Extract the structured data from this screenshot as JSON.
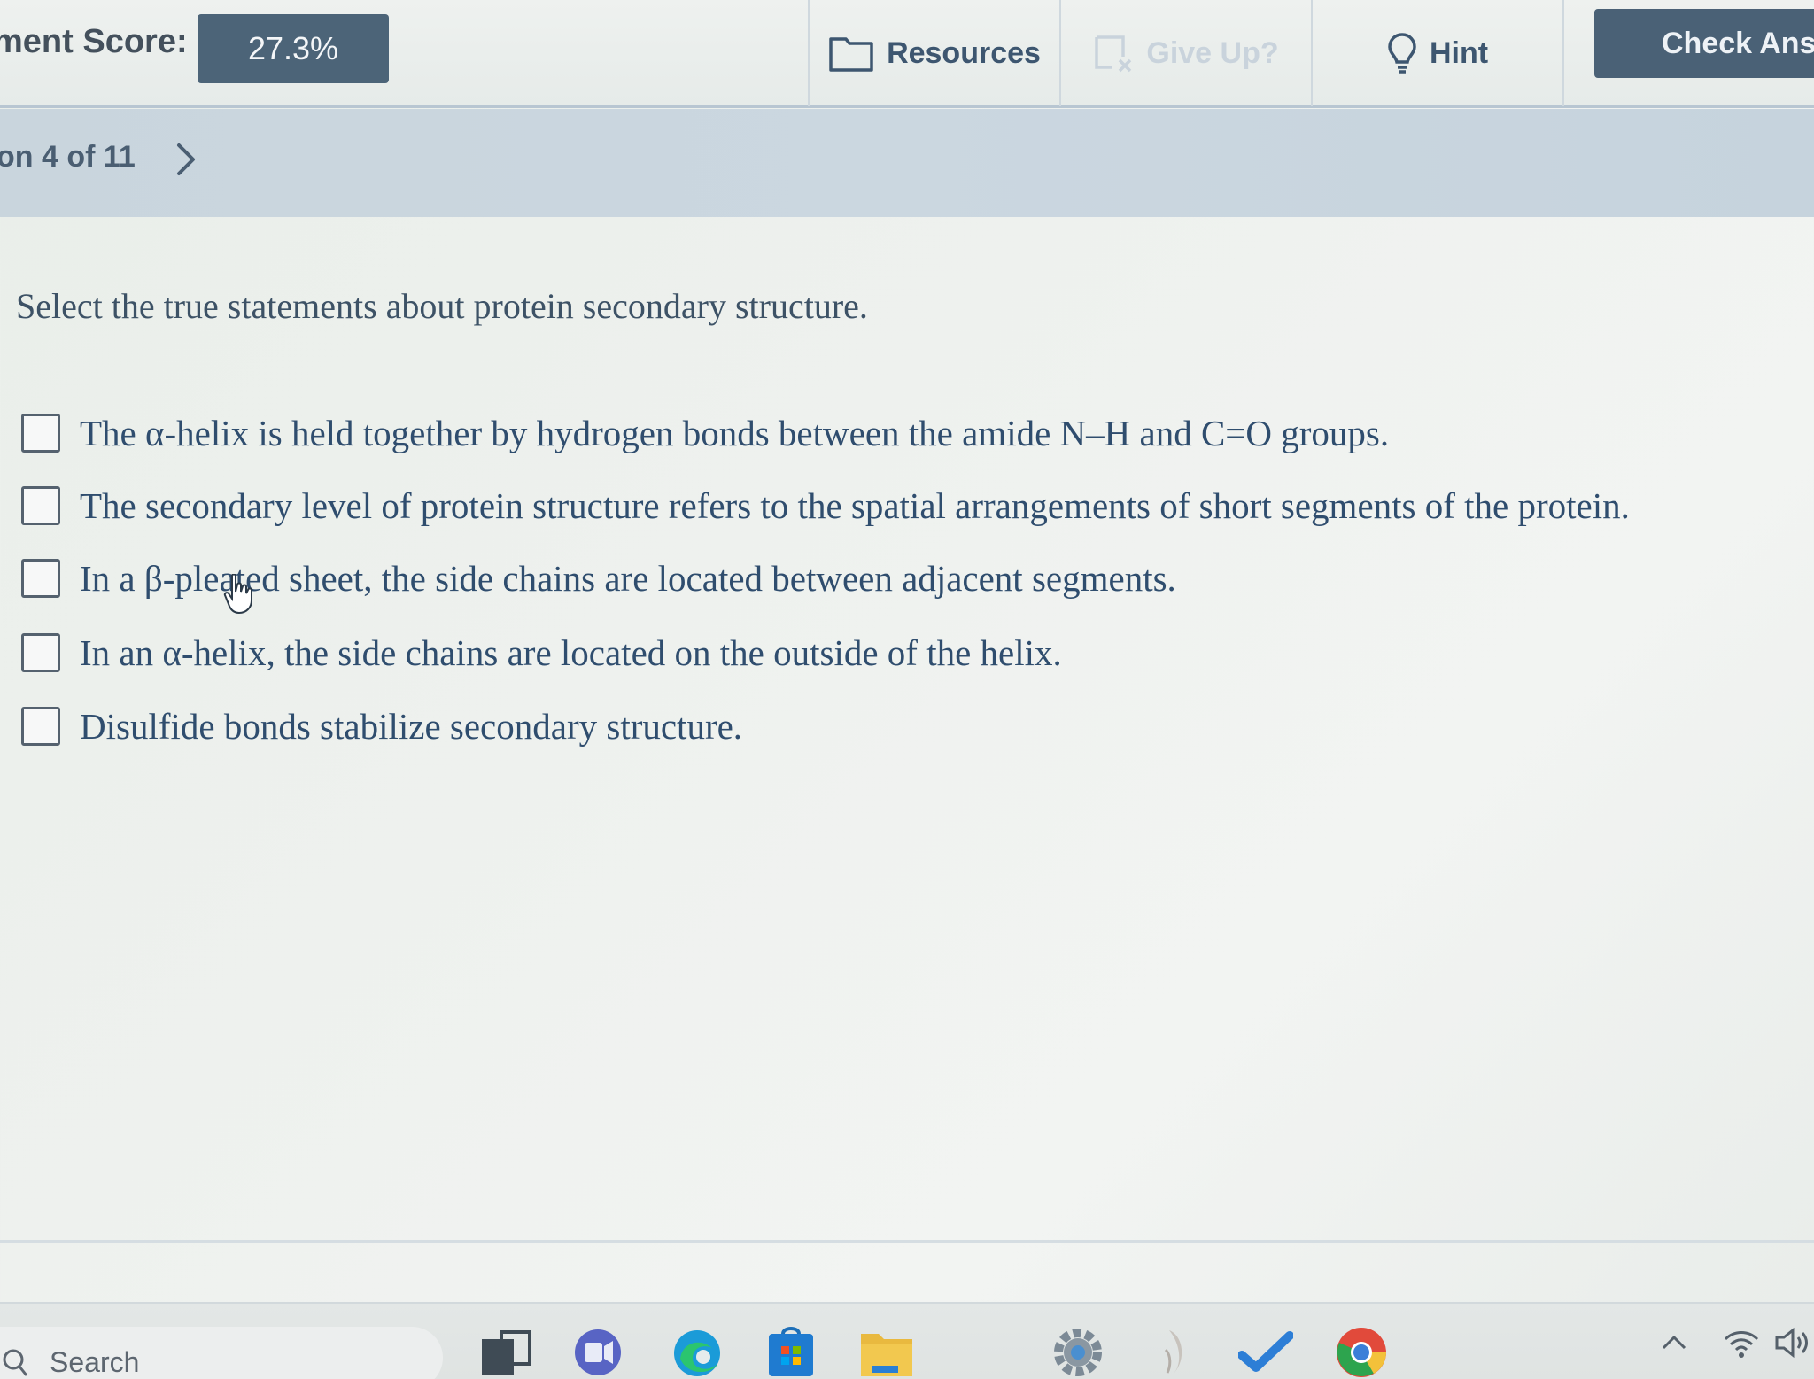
{
  "toolbar": {
    "score_label": "ment Score:",
    "score_value": "27.3%",
    "resources": "Resources",
    "give_up": "Give Up?",
    "hint": "Hint",
    "check_answer": "Check Answ"
  },
  "nav": {
    "question_position": "on 4 of 11"
  },
  "question": {
    "prompt": "Select the true statements about protein secondary structure.",
    "options": [
      {
        "label": "The α-helix is held together by hydrogen bonds between the amide N–H and C=O groups.",
        "checked": false
      },
      {
        "label": "The secondary level of protein structure refers to the spatial arrangements of short segments of the protein.",
        "checked": false
      },
      {
        "label": "In a β-pleated sheet, the side chains are located between adjacent segments.",
        "checked": false
      },
      {
        "label": "In an α-helix, the side chains are located on the outside of the helix.",
        "checked": false
      },
      {
        "label": "Disulfide bonds stabilize secondary structure.",
        "checked": false
      }
    ]
  },
  "taskbar": {
    "search_label": "Search",
    "icons": [
      "search-icon",
      "task-view-icon",
      "teams-icon",
      "edge-icon",
      "store-icon",
      "file-explorer-icon",
      "settings-icon",
      "app-icon",
      "checkmark-app-icon",
      "chrome-icon"
    ],
    "tray_icons": [
      "chevron-up-icon",
      "wifi-icon",
      "speaker-icon"
    ]
  },
  "colors": {
    "score_box": "#4c6478",
    "check_button": "#4a6176",
    "nav_bar": "#c9d5dd",
    "option_text": "#2f4d6e"
  }
}
